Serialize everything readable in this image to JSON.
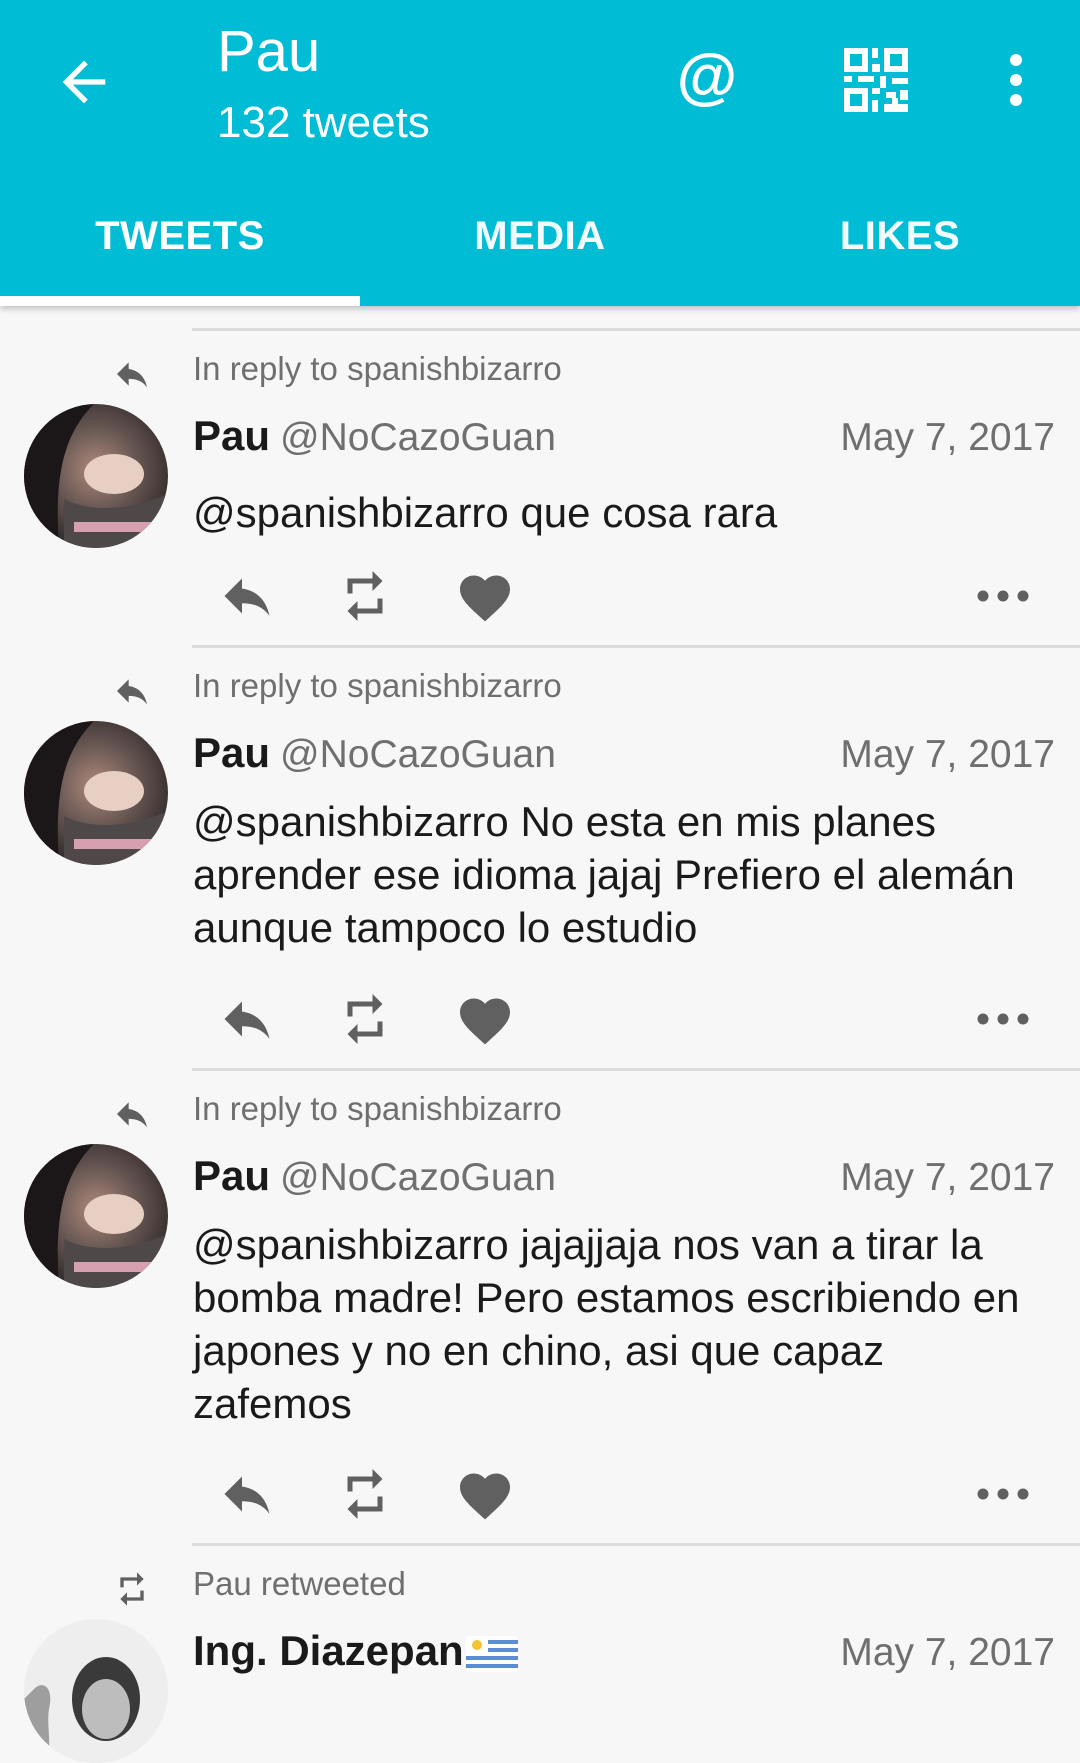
{
  "header": {
    "title": "Pau",
    "subtitle": "132 tweets",
    "mention_glyph": "@",
    "icons": [
      "back-arrow-icon",
      "at-mention-icon",
      "qr-code-icon",
      "overflow-menu-icon"
    ]
  },
  "tabs": [
    {
      "label": "TWEETS",
      "selected": true
    },
    {
      "label": "MEDIA",
      "selected": false
    },
    {
      "label": "LIKES",
      "selected": false
    }
  ],
  "colors": {
    "accent": "#00bcd4",
    "background": "#f7f7f7",
    "secondary_text": "#6f6f6f",
    "icon_gray": "#606060"
  },
  "tweets": [
    {
      "context": "In reply to spanishbizarro",
      "name": "Pau",
      "handle": "@NoCazoGuan",
      "date": "May 7, 2017",
      "text": "@spanishbizarro que cosa rara"
    },
    {
      "context": "In reply to spanishbizarro",
      "name": "Pau",
      "handle": "@NoCazoGuan",
      "date": "May 7, 2017",
      "text": "@spanishbizarro No esta en mis planes aprender ese idioma jajaj Prefiero el alemán aunque tampoco lo estudio"
    },
    {
      "context": "In reply to spanishbizarro",
      "name": "Pau",
      "handle": "@NoCazoGuan",
      "date": "May 7, 2017",
      "text": "@spanishbizarro jajajjaja nos van a tirar la bomba madre! Pero estamos escribiendo en japones y no en chino, asi que capaz zafemos"
    },
    {
      "context": "Pau retweeted",
      "name": "Ing. Diazepan",
      "date": "May 7, 2017"
    }
  ]
}
